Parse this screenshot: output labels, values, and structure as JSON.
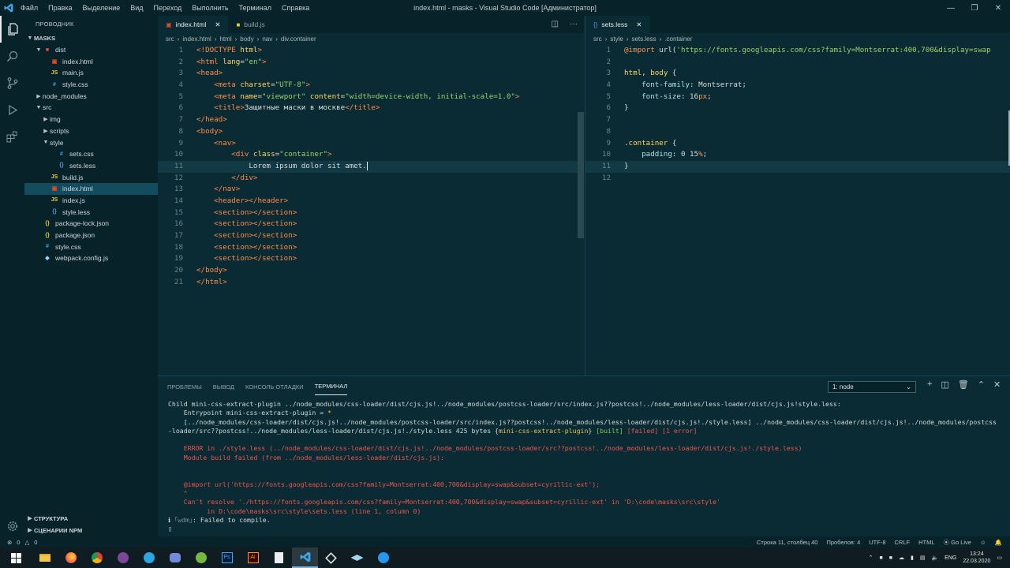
{
  "window": {
    "menu": [
      "Файл",
      "Правка",
      "Выделение",
      "Вид",
      "Переход",
      "Выполнить",
      "Терминал",
      "Справка"
    ],
    "title": "index.html - masks - Visual Studio Code [Администратор]"
  },
  "sidebar": {
    "header": "ПРОВОДНИК",
    "root": "MASKS",
    "tree": [
      {
        "label": "dist",
        "depth": 1,
        "type": "folder-open"
      },
      {
        "label": "index.html",
        "depth": 2,
        "type": "html"
      },
      {
        "label": "main.js",
        "depth": 2,
        "type": "js"
      },
      {
        "label": "style.css",
        "depth": 2,
        "type": "css"
      },
      {
        "label": "node_modules",
        "depth": 1,
        "type": "folder"
      },
      {
        "label": "src",
        "depth": 1,
        "type": "folder-open"
      },
      {
        "label": "img",
        "depth": 2,
        "type": "folder"
      },
      {
        "label": "scripts",
        "depth": 2,
        "type": "folder"
      },
      {
        "label": "style",
        "depth": 2,
        "type": "folder-open"
      },
      {
        "label": "sets.css",
        "depth": 3,
        "type": "css"
      },
      {
        "label": "sets.less",
        "depth": 3,
        "type": "less"
      },
      {
        "label": "build.js",
        "depth": 2,
        "type": "js"
      },
      {
        "label": "index.html",
        "depth": 2,
        "type": "html",
        "selected": true
      },
      {
        "label": "index.js",
        "depth": 2,
        "type": "js"
      },
      {
        "label": "style.less",
        "depth": 2,
        "type": "less"
      },
      {
        "label": "package-lock.json",
        "depth": 1,
        "type": "json"
      },
      {
        "label": "package.json",
        "depth": 1,
        "type": "json"
      },
      {
        "label": "style.css",
        "depth": 1,
        "type": "css"
      },
      {
        "label": "webpack.config.js",
        "depth": 1,
        "type": "webpack"
      }
    ],
    "bottom_sections": [
      "СТРУКТУРА",
      "СЦЕНАРИИ NPM"
    ]
  },
  "editor_left": {
    "tabs": [
      {
        "label": "index.html",
        "active": true
      },
      {
        "label": "build.js",
        "active": false
      }
    ],
    "breadcrumb": [
      "src",
      "index.html",
      "html",
      "body",
      "nav",
      "div.container"
    ],
    "lines": [
      [
        [
          "tg",
          "<!DOCTYPE "
        ],
        [
          "at",
          "html"
        ],
        [
          "tg",
          ">"
        ]
      ],
      [
        [
          "tg",
          "<html "
        ],
        [
          "at",
          "lang"
        ],
        [
          "t",
          "="
        ],
        [
          "st",
          "\"en\""
        ],
        [
          "tg",
          ">"
        ]
      ],
      [
        [
          "tg",
          "<head>"
        ]
      ],
      [
        [
          "t",
          "    "
        ],
        [
          "tg",
          "<meta "
        ],
        [
          "at",
          "charset"
        ],
        [
          "t",
          "="
        ],
        [
          "st",
          "\"UTF-8\""
        ],
        [
          "tg",
          ">"
        ]
      ],
      [
        [
          "t",
          "    "
        ],
        [
          "tg",
          "<meta "
        ],
        [
          "at",
          "name"
        ],
        [
          "t",
          "="
        ],
        [
          "st",
          "\"viewport\""
        ],
        [
          "t",
          " "
        ],
        [
          "at",
          "content"
        ],
        [
          "t",
          "="
        ],
        [
          "st",
          "\"width=device-width, initial-scale=1.0\""
        ],
        [
          "tg",
          ">"
        ]
      ],
      [
        [
          "t",
          "    "
        ],
        [
          "tg",
          "<title>"
        ],
        [
          "t",
          "Защитные маски в москве"
        ],
        [
          "tg",
          "</title>"
        ]
      ],
      [
        [
          "tg",
          "</head>"
        ]
      ],
      [
        [
          "tg",
          "<body>"
        ]
      ],
      [
        [
          "t",
          "    "
        ],
        [
          "tg",
          "<nav>"
        ]
      ],
      [
        [
          "t",
          "        "
        ],
        [
          "tg",
          "<div "
        ],
        [
          "at",
          "class"
        ],
        [
          "t",
          "="
        ],
        [
          "st",
          "\"container\""
        ],
        [
          "tg",
          ">"
        ]
      ],
      [
        [
          "t",
          "            Lorem ipsum dolor sit amet."
        ]
      ],
      [
        [
          "t",
          "        "
        ],
        [
          "tg",
          "</div>"
        ]
      ],
      [
        [
          "t",
          "    "
        ],
        [
          "tg",
          "</nav>"
        ]
      ],
      [
        [
          "t",
          "    "
        ],
        [
          "tg",
          "<header></header>"
        ]
      ],
      [
        [
          "t",
          "    "
        ],
        [
          "tg",
          "<section></section>"
        ]
      ],
      [
        [
          "t",
          "    "
        ],
        [
          "tg",
          "<section></section>"
        ]
      ],
      [
        [
          "t",
          "    "
        ],
        [
          "tg",
          "<section></section>"
        ]
      ],
      [
        [
          "t",
          "    "
        ],
        [
          "tg",
          "<section></section>"
        ]
      ],
      [
        [
          "t",
          "    "
        ],
        [
          "tg",
          "<section></section>"
        ]
      ],
      [
        [
          "tg",
          "</body>"
        ]
      ],
      [
        [
          "tg",
          "</html>"
        ]
      ]
    ],
    "current_line": 11
  },
  "editor_right": {
    "tabs": [
      {
        "label": "sets.less",
        "active": true
      }
    ],
    "breadcrumb": [
      "src",
      "style",
      "sets.less",
      ".container"
    ],
    "lines": [
      [
        [
          "kw",
          "@import "
        ],
        [
          "t",
          "url("
        ],
        [
          "st",
          "'https://fonts.googleapis.com/css?family=Montserrat:400,700&display=swap"
        ]
      ],
      [],
      [
        [
          "sel2",
          "html"
        ],
        [
          "t",
          ", "
        ],
        [
          "sel2",
          "body"
        ],
        [
          "t",
          " {"
        ]
      ],
      [
        [
          "t",
          "    "
        ],
        [
          "pr",
          "font-family"
        ],
        [
          "t",
          ": Montserrat;"
        ]
      ],
      [
        [
          "t",
          "    "
        ],
        [
          "pr",
          "font-size"
        ],
        [
          "t",
          ": 16"
        ],
        [
          "kw",
          "px"
        ],
        [
          "t",
          ";"
        ]
      ],
      [
        [
          "t",
          "}"
        ]
      ],
      [],
      [],
      [
        [
          "sel2",
          ".container"
        ],
        [
          "t",
          " {"
        ]
      ],
      [
        [
          "t",
          "    "
        ],
        [
          "pr",
          "padding"
        ],
        [
          "t",
          ": 0 15"
        ],
        [
          "kw",
          "%"
        ],
        [
          "t",
          ";"
        ]
      ],
      [
        [
          "t",
          "}"
        ]
      ],
      []
    ],
    "current_line": 11
  },
  "panel": {
    "tabs": [
      "ПРОБЛЕМЫ",
      "ВЫВОД",
      "КОНСОЛЬ ОТЛАДКИ",
      "ТЕРМИНАЛ"
    ],
    "active_tab": "ТЕРМИНАЛ",
    "terminal_select": "1: node",
    "terminal": [
      [
        [
          "t",
          "Child mini-css-extract-plugin ../node_modules/css-loader/dist/cjs.js!../node_modules/postcss-loader/src/index.js??postcss!../node_modules/less-loader/dist/cjs.js!style.less:"
        ]
      ],
      [
        [
          "t",
          "    Entrypoint mini-css-extract-plugin = "
        ],
        [
          "ylw",
          "*"
        ]
      ],
      [
        [
          "t",
          "    [../node_modules/css-loader/dist/cjs.js!../node_modules/postcss-loader/src/index.js??postcss!../node_modules/less-loader/dist/cjs.js!./style.less] ../node_modules/css-loader/dist/cjs.js!../node_modules/postcss"
        ]
      ],
      [
        [
          "t",
          "-loader/src??postcss!../node_modules/less-loader/dist/cjs.js!./style.less 425 bytes {"
        ],
        [
          "ylw",
          "mini-css-extract-plugin"
        ],
        [
          "t",
          "} "
        ],
        [
          "grn",
          "[built]"
        ],
        [
          "t",
          " "
        ],
        [
          "red",
          "[failed] [1 error]"
        ]
      ],
      [],
      [
        [
          "red",
          "    ERROR in ./style.less (../node_modules/css-loader/dist/cjs.js!../node_modules/postcss-loader/src??postcss!../node_modules/less-loader/dist/cjs.js!./style.less)"
        ]
      ],
      [
        [
          "red",
          "    Module build failed (from ../node_modules/less-loader/dist/cjs.js):"
        ]
      ],
      [],
      [],
      [
        [
          "red",
          "    @import url('https://fonts.googleapis.com/css?family=Montserrat:400,700&display=swap&subset=cyrillic-ext');"
        ]
      ],
      [
        [
          "red",
          "    ^"
        ]
      ],
      [
        [
          "red",
          "    Can't resolve './https://fonts.googleapis.com/css?family=Montserrat:400,700&display=swap&subset=cyrillic-ext' in 'D:\\code\\masks\\src\\style'"
        ]
      ],
      [
        [
          "red",
          "          in D:\\code\\masks\\src\\style\\sets.less (line 1, column 0)"
        ]
      ],
      [
        [
          "t",
          "ℹ "
        ],
        [
          "dim",
          "｢wdm｣"
        ],
        [
          "t",
          ": Failed to compile."
        ]
      ],
      [
        [
          "t",
          "▯"
        ]
      ]
    ]
  },
  "statusbar": {
    "errors": "0",
    "warnings": "0",
    "position": "Строка 11, столбец 40",
    "spaces": "Пробелов: 4",
    "encoding": "UTF-8",
    "eol": "CRLF",
    "language": "HTML",
    "golive": "Go Live"
  },
  "taskbar": {
    "lang": "ENG",
    "time": "13:24",
    "date": "22.03.2020"
  },
  "colors": {
    "accent": "#124c5e",
    "bg": "#0a2b33",
    "error": "#f2534c"
  }
}
